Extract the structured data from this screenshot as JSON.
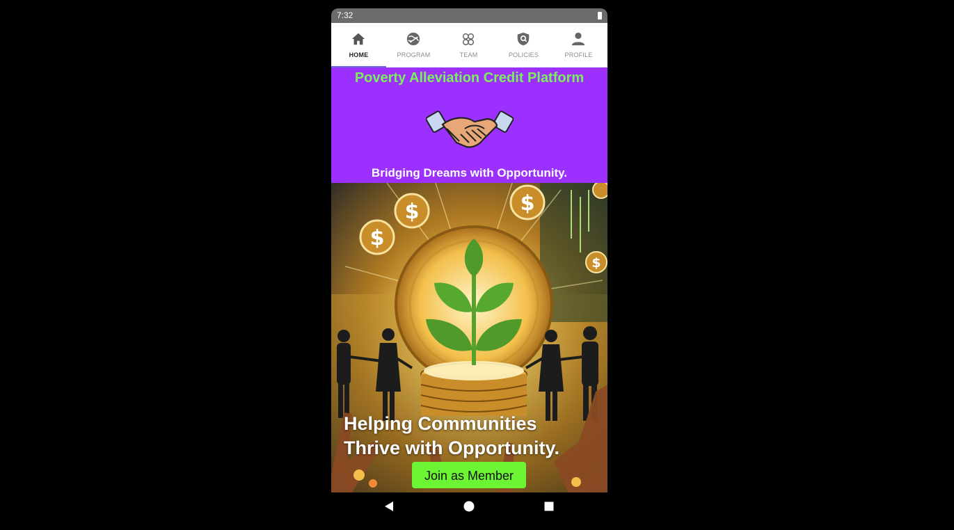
{
  "status_bar": {
    "time": "7:32"
  },
  "tabs": [
    {
      "label": "HOME",
      "icon": "home-icon",
      "active": true
    },
    {
      "label": "PROGRAM",
      "icon": "globe-icon",
      "active": false
    },
    {
      "label": "TEAM",
      "icon": "team-icon",
      "active": false
    },
    {
      "label": "POLICIES",
      "icon": "shield-icon",
      "active": false
    },
    {
      "label": "PROFILE",
      "icon": "person-icon",
      "active": false
    }
  ],
  "hero": {
    "title": "Poverty Alleviation Credit Platform",
    "tagline": "Bridging Dreams with Opportunity.",
    "image_icon": "handshake-icon",
    "headline_line1": "Helping Communities",
    "headline_line2": "Thrive with Opportunity.",
    "cta_label": "Join as Member"
  },
  "colors": {
    "header_bg": "#9b30ff",
    "title_green": "#7cf05a",
    "cta_green": "#6cf535",
    "active_indicator": "#6a6ad8"
  },
  "nav_bar": {
    "back": "back-icon",
    "home": "home-circle-icon",
    "recents": "recents-icon"
  }
}
